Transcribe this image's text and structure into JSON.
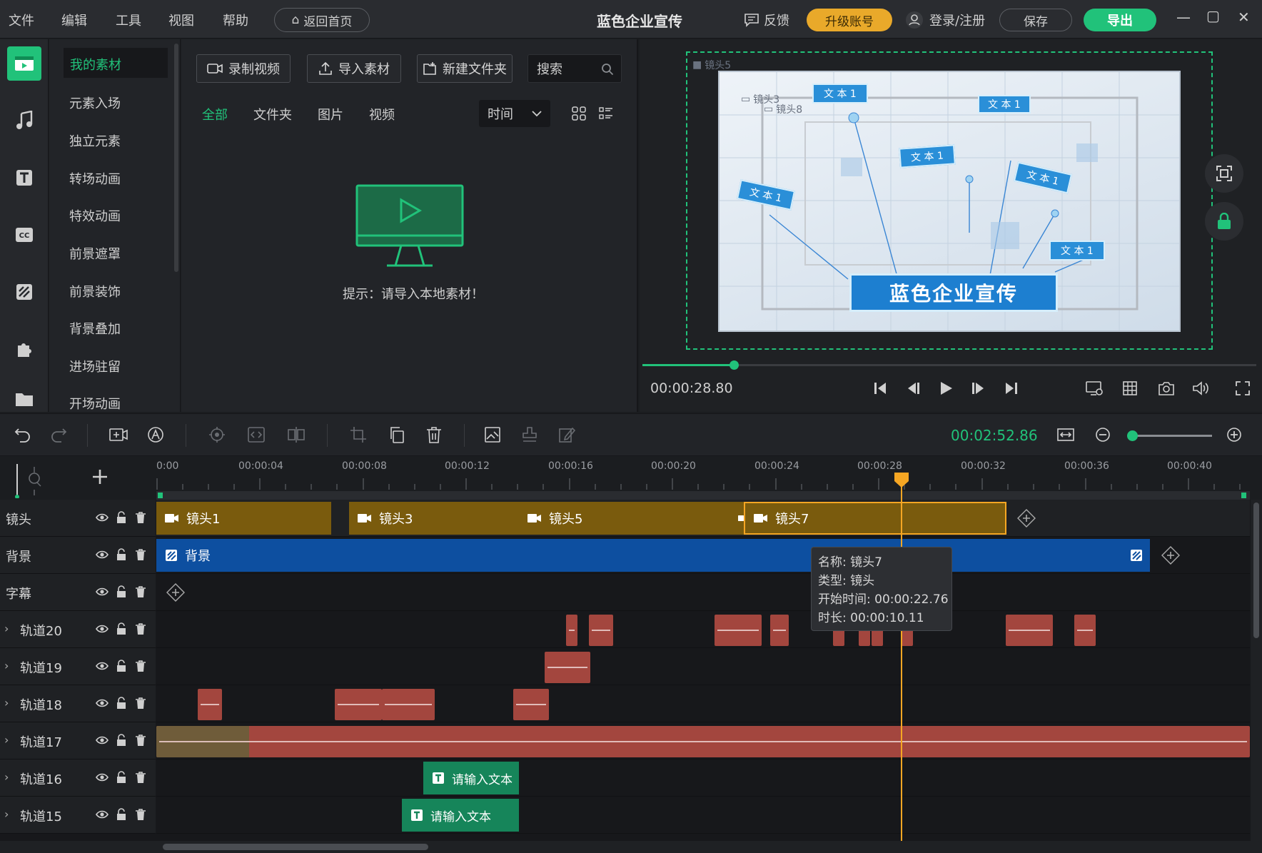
{
  "menu": {
    "items": [
      "文件",
      "编辑",
      "工具",
      "视图",
      "帮助"
    ],
    "home_button": "返回首页",
    "app_title": "蓝色企业宣传",
    "feedback": "反馈",
    "upgrade": "升级账号",
    "login": "登录/注册",
    "save": "保存",
    "export": "导出"
  },
  "categories": {
    "items": [
      "我的素材",
      "元素入场",
      "独立元素",
      "转场动画",
      "特效动画",
      "前景遮罩",
      "前景装饰",
      "背景叠加",
      "进场驻留",
      "开场动画"
    ]
  },
  "media": {
    "record": "录制视频",
    "import": "导入素材",
    "new_folder": "新建文件夹",
    "search_placeholder": "搜索",
    "tabs": [
      "全部",
      "文件夹",
      "图片",
      "视频"
    ],
    "sort": "时间",
    "hint": "提示：请导入本地素材！"
  },
  "preview": {
    "canvas_title": "蓝色企业宣传",
    "text_label": "文本1",
    "text_label_spaced": "文 本 1",
    "cam_labels": [
      "镜头5",
      "镜头3",
      "镜头8"
    ],
    "current_time": "00:00:28.80",
    "progress_fraction": 0.149
  },
  "toolbar": {
    "total_time": "00:02:52.86"
  },
  "timeline": {
    "ticks": [
      "0:00",
      "00:00:04",
      "00:00:08",
      "00:00:12",
      "00:00:16",
      "00:00:20",
      "00:00:24",
      "00:00:28",
      "00:00:32",
      "00:00:36",
      "00:00:40"
    ],
    "tracks": [
      "镜头",
      "背景",
      "字幕",
      "轨道20",
      "轨道19",
      "轨道18",
      "轨道17",
      "轨道16",
      "轨道15"
    ],
    "camera_clips": [
      "镜头1",
      "镜头3",
      "镜头5",
      "镜头7"
    ],
    "background_clip": "背景",
    "text_clips": [
      "请输入文本",
      "请输入文本"
    ],
    "tooltip": {
      "name": "名称: 镜头7",
      "type": "类型: 镜头",
      "start": "开始时间: 00:00:22.76",
      "duration": "时长: 00:00:10.11"
    }
  },
  "colors": {
    "accent": "#21c27a",
    "upgrade": "#e9a92a",
    "playhead": "#f5a623",
    "camera_clip": "#7a5b0d",
    "background_clip": "#0d4fa0",
    "audio_clip": "#a3463e",
    "text_clip": "#16855a"
  }
}
